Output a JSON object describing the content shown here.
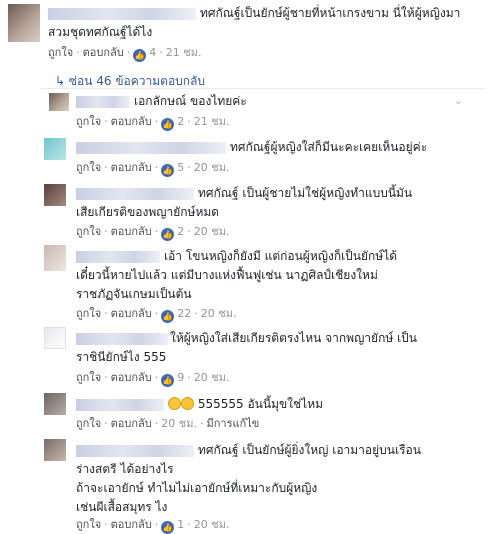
{
  "top_comment": {
    "text_line1": "ทศกัณฐ์เป็นยักษ์ผู้ชายที่หน้าเกรงขาม นี่ให้ผู้หญิงมา",
    "text_line2": "สวมชุดทศกัณฐ์ได้ไง",
    "like_label": "ถูกใจ",
    "reply_label": "ตอบกลับ",
    "like_count": "4",
    "time": "21 ชม."
  },
  "replies_toggle": {
    "arrow": "↳",
    "label": "ซ่อน 46 ข้อความตอบกลับ"
  },
  "replies": [
    {
      "text_lines": [
        "เอกลักษณ์ ของไทยค่ะ"
      ],
      "like_label": "ถูกใจ",
      "reply_label": "ตอบกลับ",
      "like_count": "2",
      "time": "21 ชม.",
      "edited": ""
    },
    {
      "text_lines": [
        "ทศกัณฐ์ผู้หญิงใส่ก็มีนะคะเคยเห็นอยู่ค่ะ"
      ],
      "like_label": "ถูกใจ",
      "reply_label": "ตอบกลับ",
      "like_count": "5",
      "time": "20 ชม.",
      "edited": ""
    },
    {
      "text_lines": [
        "ทศกัณฐ์ เป็นผู้ชายไม่ใช่ผู้หญิงทำแบบนี้มัน",
        "เสียเกียรติของพญายักษ์หมด"
      ],
      "like_label": "ถูกใจ",
      "reply_label": "ตอบกลับ",
      "like_count": "2",
      "time": "20 ชม.",
      "edited": ""
    },
    {
      "text_lines": [
        "เอ้า โขนหญิงก็ยังมี แต่ก่อนผู้หญิงก็เป็นยักษ์ได้",
        "เดี๋ยวนี้หายไปแล้ว แต่มีบางแห่งฟื้นฟูเช่น นาฏศิลป์เชียงใหม่",
        "ราชภัฏจันเกษมเป็นต้น"
      ],
      "like_label": "ถูกใจ",
      "reply_label": "ตอบกลับ",
      "like_count": "22",
      "time": "20 ชม.",
      "edited": ""
    },
    {
      "text_lines": [
        "ให้ผู้หญิงใส่เสียเกียรติตรงไหน จากพญายักษ์ เป็น",
        "ราชินียักษ์ไง 555"
      ],
      "like_label": "ถูกใจ",
      "reply_label": "ตอบกลับ",
      "like_count": "9",
      "time": "20 ชม.",
      "edited": ""
    },
    {
      "text_lines": [
        "555555 อันนี้มุขใช่ไหม"
      ],
      "like_label": "ถูกใจ",
      "reply_label": "ตอบกลับ",
      "like_count": "",
      "time": "20 ชม.",
      "edited": "มีการแก้ไข"
    },
    {
      "text_lines": [
        "ทศกัณฐ์ เป็นยักษ์ผู้ยิ่งใหญ่ เอามาอยู่บนเรือน",
        "ร่างสตรี ได้อย่างไร",
        "ถ้าจะเอายักษ์ ทำไมไม่เอายักษ์ที่เหมาะกับผู้หญิง",
        "เช่นผีเสื้อสมุทร ไง"
      ],
      "like_label": "ถูกใจ",
      "reply_label": "ตอบกลับ",
      "like_count": "1",
      "time": "20 ชม.",
      "edited": ""
    }
  ],
  "icons": {
    "like": "thumbs-up-icon",
    "collapse": "chevron-down-icon",
    "reply_arrow": "reply-arrow-icon"
  },
  "colors": {
    "link": "#365899",
    "meta": "#90949c",
    "like_blue": "#4267b2"
  }
}
